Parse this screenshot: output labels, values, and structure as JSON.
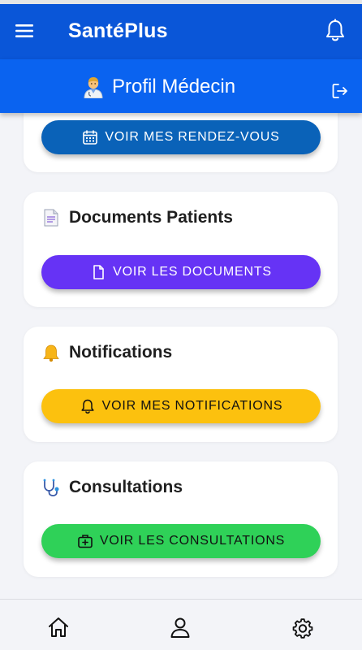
{
  "app": {
    "title": "SantéPlus"
  },
  "subheader": {
    "title": "Profil Médecin"
  },
  "cards": {
    "appointments": {
      "button": "VOIR MES RENDEZ-VOUS",
      "color": "#0a62b8"
    },
    "documents": {
      "title": "Documents Patients",
      "button": "VOIR LES DOCUMENTS",
      "color": "#6633f5"
    },
    "notifications": {
      "title": "Notifications",
      "button": "VOIR MES NOTIFICATIONS",
      "color": "#fcc10e"
    },
    "consultations": {
      "title": "Consultations",
      "button": "VOIR LES CONSULTATIONS",
      "color": "#2fd158"
    }
  },
  "icons": {
    "menu": "menu-icon",
    "notifications": "bell-icon",
    "doctor": "doctor-emoji-icon",
    "logout": "logout-icon",
    "calendar": "calendar-icon",
    "document": "document-icon",
    "bell": "bell-emoji-icon",
    "stethoscope": "stethoscope-icon",
    "medical_bag": "medical-bag-icon",
    "home": "home-icon",
    "profile": "user-icon",
    "settings": "gear-icon"
  },
  "colors": {
    "primary": "#0a56d8",
    "secondary": "#0a63f0",
    "background": "#f3f4f8"
  }
}
